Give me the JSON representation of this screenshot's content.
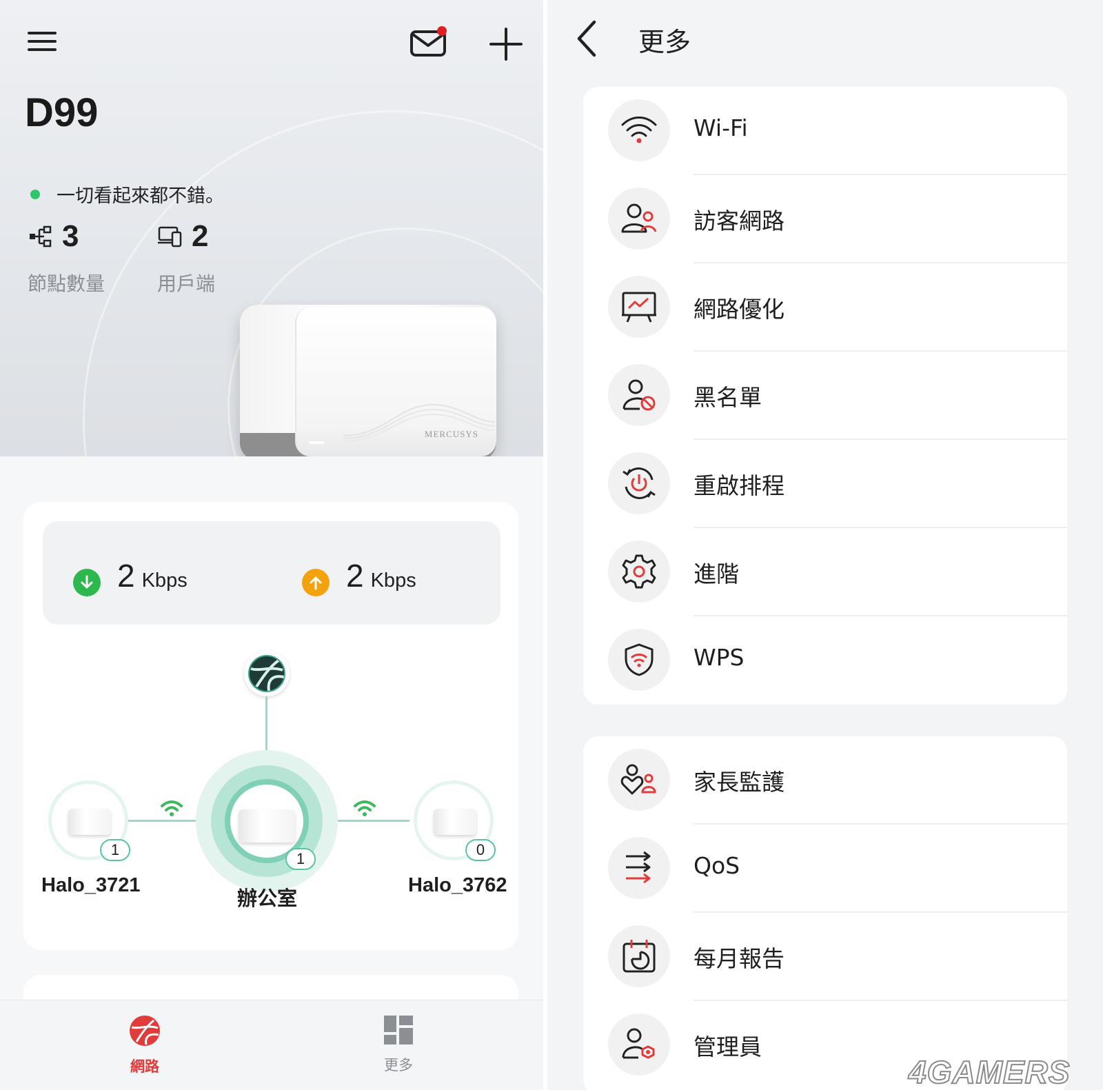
{
  "network_screen": {
    "site_name": "D99",
    "status_text": "一切看起來都不錯。",
    "node_count": "3",
    "node_count_label": "節點數量",
    "client_count": "2",
    "client_count_label": "用戶端",
    "device_brand": "MERCUSYS",
    "download_value": "2",
    "download_unit": "Kbps",
    "upload_value": "2",
    "upload_unit": "Kbps",
    "nodes": [
      {
        "name": "Halo_3721",
        "clients": "1"
      },
      {
        "name": "辦公室",
        "clients": "1"
      },
      {
        "name": "Halo_3762",
        "clients": "0"
      }
    ],
    "tabs": [
      {
        "label": "網路",
        "active": true
      },
      {
        "label": "更多",
        "active": false
      }
    ],
    "colors": {
      "accent_red": "#e23b3b",
      "status_green": "#2ec56b",
      "download_green": "#2db84d",
      "upload_orange": "#f2a20c",
      "link_teal": "#59c3a6"
    }
  },
  "more_screen": {
    "title": "更多",
    "group1": [
      {
        "label": "Wi-Fi",
        "icon": "wifi-icon"
      },
      {
        "label": "訪客網路",
        "icon": "guest-network-icon"
      },
      {
        "label": "網路優化",
        "icon": "network-optimize-icon"
      },
      {
        "label": "黑名單",
        "icon": "blacklist-icon"
      },
      {
        "label": "重啟排程",
        "icon": "reboot-schedule-icon"
      },
      {
        "label": "進階",
        "icon": "gear-icon"
      },
      {
        "label": "WPS",
        "icon": "wps-shield-icon"
      }
    ],
    "group2": [
      {
        "label": "家長監護",
        "icon": "parental-control-icon"
      },
      {
        "label": "QoS",
        "icon": "qos-icon"
      },
      {
        "label": "每月報告",
        "icon": "monthly-report-icon"
      },
      {
        "label": "管理員",
        "icon": "admin-icon"
      }
    ]
  },
  "watermark": "4GAMERS"
}
